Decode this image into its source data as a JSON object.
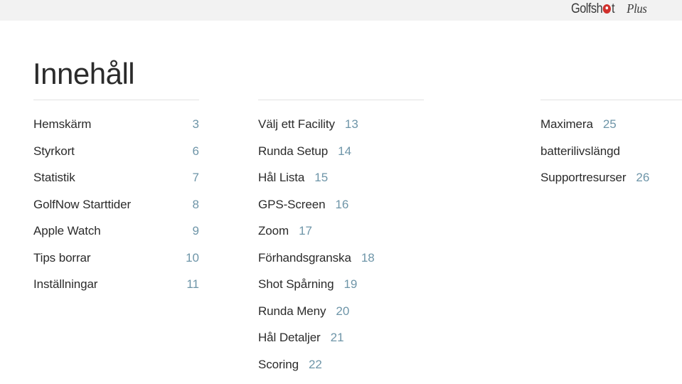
{
  "header": {
    "brand_name": "Golfshot",
    "brand_prefix": "Golf",
    "brand_middle": "sh",
    "brand_suffix": "t",
    "brand_plus": "Plus",
    "logo_icon": "golf-ball-pin-icon",
    "band_color": "#f2f2f2",
    "accent_red": "#d0312d"
  },
  "page_title": "Innehåll",
  "theme": {
    "page_number_color": "#6e95a8",
    "label_color": "#2b2b2b",
    "rule_color": "#e2e2e2",
    "background": "#ffffff"
  },
  "columns": [
    {
      "id": "column-1",
      "entries": [
        {
          "label": "Hemskärm",
          "page": "3"
        },
        {
          "label": "Styrkort",
          "page": "6"
        },
        {
          "label": "Statistik",
          "page": "7"
        },
        {
          "label": "GolfNow Starttider",
          "page": "8"
        },
        {
          "label": "Apple Watch",
          "page": "9"
        },
        {
          "label": "Tips borrar",
          "page": "10"
        },
        {
          "label": "Inställningar",
          "page": "11"
        }
      ]
    },
    {
      "id": "column-2",
      "entries": [
        {
          "label": "Välj ett Facility",
          "page": "13"
        },
        {
          "label": "Runda Setup",
          "page": "14"
        },
        {
          "label": "Hål Lista",
          "page": "15"
        },
        {
          "label": "GPS-Screen",
          "page": "16"
        },
        {
          "label": "Zoom",
          "page": "17"
        },
        {
          "label": "Förhandsgranska",
          "page": "18"
        },
        {
          "label": "Shot Spårning",
          "page": "19"
        },
        {
          "label": "Runda Meny",
          "page": "20"
        },
        {
          "label": "Hål Detaljer",
          "page": "21"
        },
        {
          "label": "Scoring",
          "page": "22"
        }
      ]
    },
    {
      "id": "column-3",
      "entries": [
        {
          "label": "Maximera",
          "page": "25"
        },
        {
          "label": "batterilivslängd",
          "page": ""
        },
        {
          "label": "Supportresurser",
          "page": "26"
        }
      ]
    }
  ]
}
